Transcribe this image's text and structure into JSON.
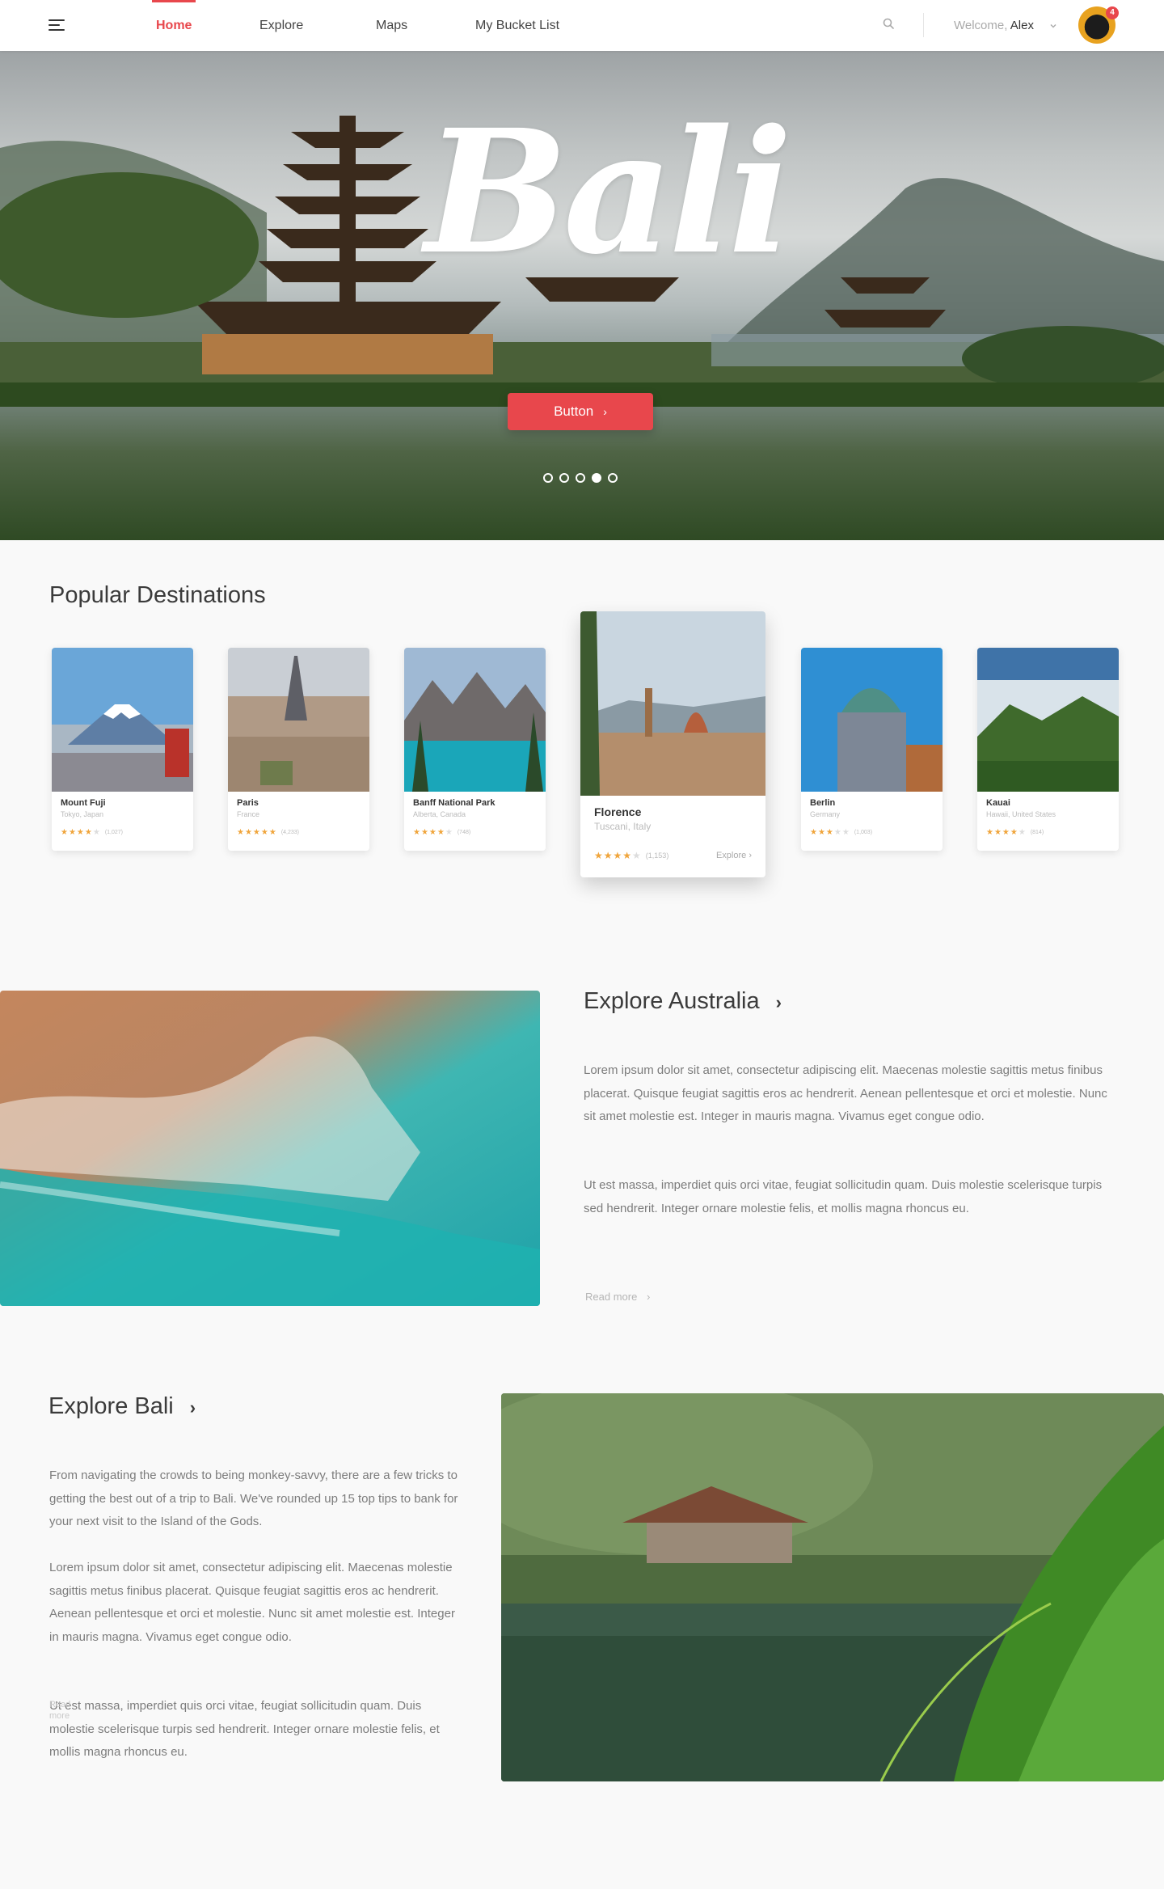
{
  "nav": {
    "links": [
      "Home",
      "Explore",
      "Maps",
      "My Bucket List"
    ],
    "welcome_prefix": "Welcome,",
    "user_name": "Alex",
    "notification_count": "4"
  },
  "hero": {
    "title": "Bali",
    "button_label": "Button",
    "slide_count": 5,
    "active_slide": 4
  },
  "popular": {
    "title": "Popular Destinations",
    "cards": [
      {
        "name": "Mount Fuji",
        "location": "Tokyo, Japan",
        "rating": 4.5,
        "reviews": "(1,027)"
      },
      {
        "name": "Paris",
        "location": "France",
        "rating": 5,
        "reviews": "(4,233)"
      },
      {
        "name": "Banff National Park",
        "location": "Alberta, Canada",
        "rating": 3.5,
        "reviews": "(748)"
      },
      {
        "name": "Florence",
        "location": "Tuscani, Italy",
        "rating": 4,
        "reviews": "(1,153)",
        "action": "Explore"
      },
      {
        "name": "Berlin",
        "location": "Germany",
        "rating": 3,
        "reviews": "(1,003)"
      },
      {
        "name": "Kauai",
        "location": "Hawaii, United States",
        "rating": 4,
        "reviews": "(814)"
      }
    ]
  },
  "australia": {
    "title": "Explore Australia",
    "paragraphs": [
      "Lorem ipsum dolor sit amet, consectetur adipiscing elit. Maecenas molestie sagittis metus finibus placerat. Quisque feugiat sagittis eros ac hendrerit. Aenean pellentesque et orci et molestie. Nunc sit amet molestie est. Integer in mauris magna. Vivamus eget congue odio.",
      "Ut est massa, imperdiet quis orci vitae, feugiat sollicitudin quam. Duis molestie scelerisque turpis sed hendrerit. Integer ornare molestie felis, et mollis magna rhoncus eu."
    ],
    "read_more": "Read more"
  },
  "bali": {
    "title": "Explore Bali",
    "paragraphs": [
      "From navigating the crowds to being monkey-savvy, there are a few tricks to getting the best out of a trip to Bali. We've rounded up 15 top tips to bank for your next visit to the Island of the Gods.",
      "Lorem ipsum dolor sit amet, consectetur adipiscing elit. Maecenas molestie sagittis metus finibus placerat. Quisque feugiat sagittis eros ac hendrerit. Aenean pellentesque et orci et molestie. Nunc sit amet molestie est. Integer in mauris magna. Vivamus eget congue odio.",
      "Ut est massa, imperdiet quis orci vitae, feugiat sollicitudin quam. Duis molestie scelerisque turpis sed hendrerit. Integer ornare molestie felis, et mollis magna rhoncus eu."
    ],
    "ghost_label": "Read more"
  },
  "colors": {
    "accent": "#e8474c",
    "star": "#f0a53c",
    "text": "#3b3b3b",
    "muted": "#7c7c7c"
  }
}
